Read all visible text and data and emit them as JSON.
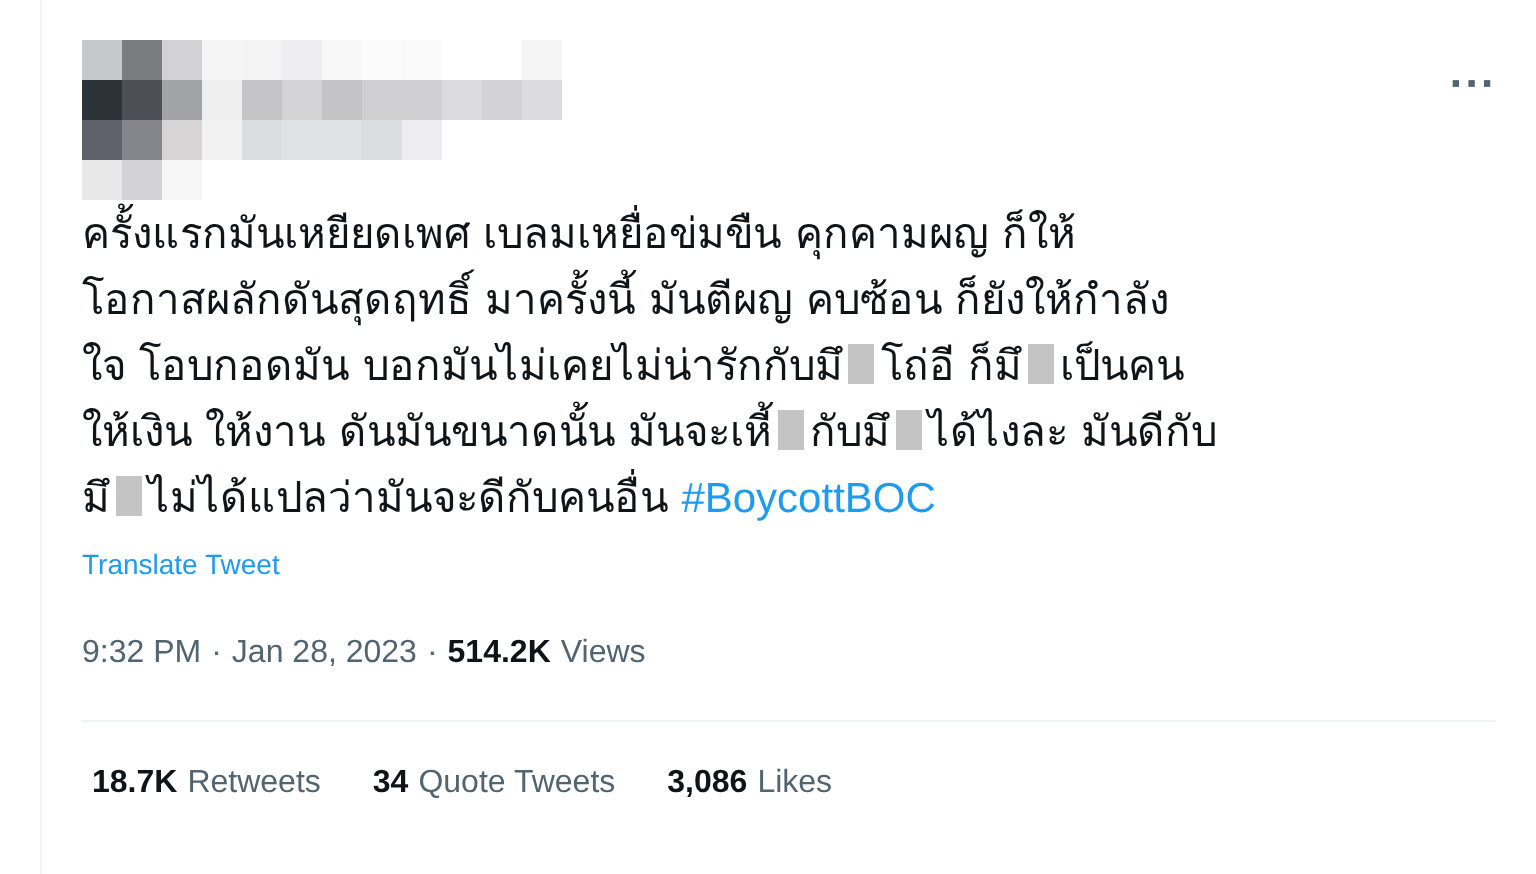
{
  "tweet": {
    "more_button": "···",
    "lines": [
      [
        {
          "kind": "text",
          "text": "ครั้งแรกมันเหยียดเพศ เบลมเหยื่อข่มขืน คุกคามผญ ก็ให้"
        }
      ],
      [
        {
          "kind": "text",
          "text": "โอกาสผลักดันสุดฤทธิ์ มาครั้งนี้ มันตีผญ คบซ้อน ก็ยังให้กำลัง"
        }
      ],
      [
        {
          "kind": "text",
          "text": "ใจ โอบกอดมัน บอกมันไม่เคยไม่น่ารักกับมึ"
        },
        {
          "kind": "redacted"
        },
        {
          "kind": "text",
          "text": "โถ่อี ก็มึ"
        },
        {
          "kind": "redacted"
        },
        {
          "kind": "text",
          "text": "เป็นคน"
        }
      ],
      [
        {
          "kind": "text",
          "text": "ให้เงิน ให้งาน ดันมันขนาดนั้น มันจะเหี้"
        },
        {
          "kind": "redacted"
        },
        {
          "kind": "text",
          "text": "กับมึ"
        },
        {
          "kind": "redacted"
        },
        {
          "kind": "text",
          "text": "ได้ไงละ มันดีกับ"
        }
      ],
      [
        {
          "kind": "text",
          "text": "มึ"
        },
        {
          "kind": "redacted"
        },
        {
          "kind": "text",
          "text": "ไม่ได้แปลว่ามันจะดีกับคนอื่น "
        },
        {
          "kind": "hashtag",
          "text": "#BoycottBOC"
        }
      ]
    ],
    "translate_link": "Translate Tweet",
    "time": "9:32 PM",
    "separator_1": "·",
    "date": "Jan 28, 2023",
    "separator_2": "·",
    "views_count": "514.2K",
    "views_label": "Views",
    "stats": [
      {
        "count": "18.7K",
        "label": "Retweets"
      },
      {
        "count": "34",
        "label": "Quote Tweets"
      },
      {
        "count": "3,086",
        "label": "Likes"
      }
    ]
  }
}
